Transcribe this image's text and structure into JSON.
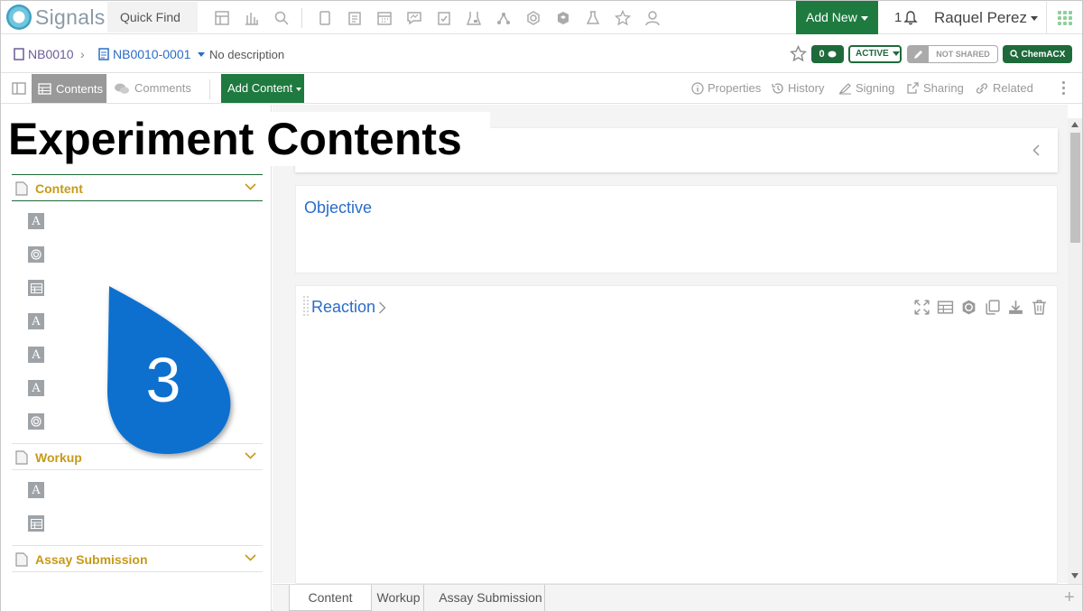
{
  "app": {
    "brand": "Signals",
    "quick_find": "Quick Find",
    "add_new": "Add New",
    "notifications_count": "1",
    "user_name": "Raquel Perez"
  },
  "toolbar_icons": [
    "layout-icon",
    "chart-icon",
    "search-icon",
    "notebook-icon",
    "clipboard-icon",
    "calendar-icon",
    "chart-comment-icon",
    "task-icon",
    "lab-icon",
    "network-icon",
    "molecule-icon",
    "box-icon",
    "flask-icon",
    "star-icon",
    "user-icon"
  ],
  "breadcrumb": {
    "notebook": "NB0010",
    "experiment": "NB0010-0001",
    "description": "No description"
  },
  "status": {
    "comments": "0",
    "state": "ACTIVE",
    "sharing": "NOT SHARED",
    "chemacx": "ChemACX"
  },
  "toolbar": {
    "contents": "Contents",
    "comments": "Comments",
    "add_content": "Add Content",
    "properties": "Properties",
    "history": "History",
    "signing": "Signing",
    "sharing": "Sharing",
    "related": "Related"
  },
  "overlay_title": "Experiment Contents",
  "sections": [
    {
      "name": "Content",
      "items": [
        "text",
        "reaction",
        "table",
        "text",
        "text",
        "text",
        "reaction"
      ]
    },
    {
      "name": "Workup",
      "items": [
        "text",
        "table"
      ]
    },
    {
      "name": "Assay Submission",
      "items": []
    }
  ],
  "cards": {
    "objective": "Objective",
    "reaction": "Reaction"
  },
  "bottom_tabs": [
    "Content",
    "Workup",
    "Assay Submission"
  ],
  "callout_number": "3",
  "colors": {
    "brand_green": "#1e7a3f",
    "link_blue": "#2a6cc7",
    "section_gold": "#c69a19",
    "callout_blue": "#0a6fcf"
  }
}
